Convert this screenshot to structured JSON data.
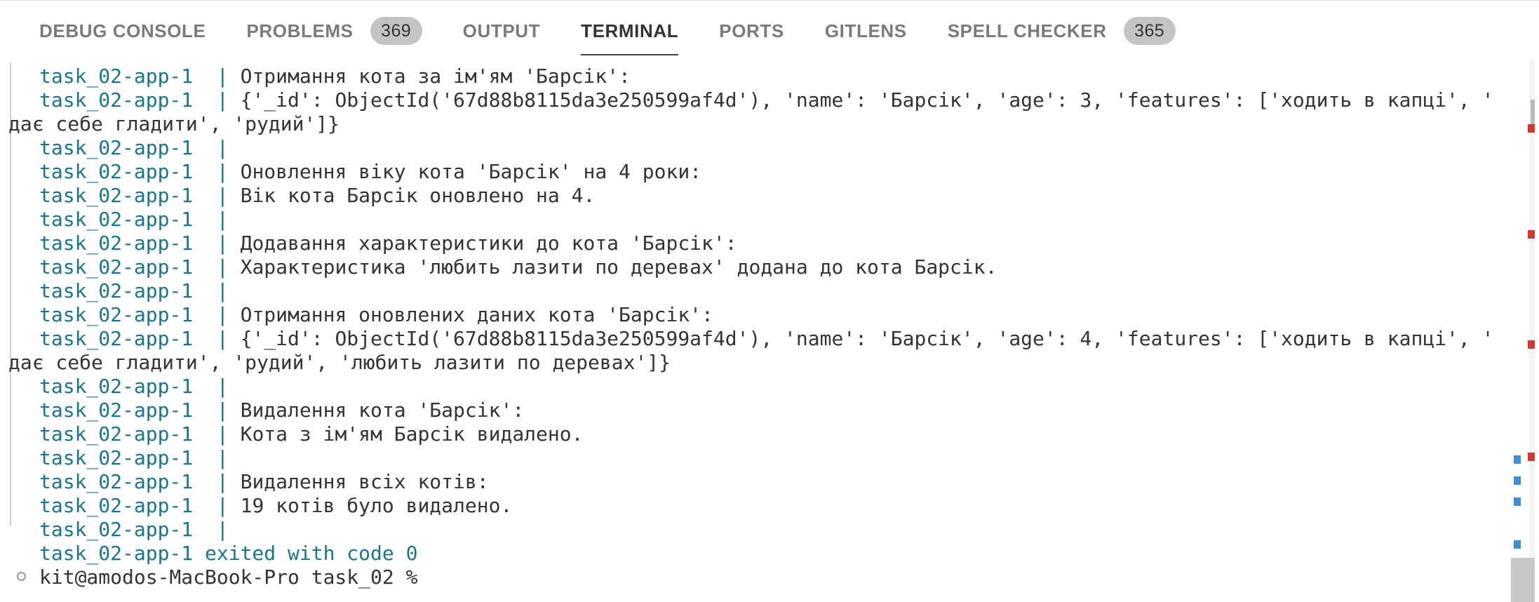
{
  "tabs": [
    {
      "label": "DEBUG CONSOLE",
      "badge": null,
      "active": false
    },
    {
      "label": "PROBLEMS",
      "badge": "369",
      "active": false
    },
    {
      "label": "OUTPUT",
      "badge": null,
      "active": false
    },
    {
      "label": "TERMINAL",
      "badge": null,
      "active": true
    },
    {
      "label": "PORTS",
      "badge": null,
      "active": false
    },
    {
      "label": "GITLENS",
      "badge": null,
      "active": false
    },
    {
      "label": "SPELL CHECKER",
      "badge": "365",
      "active": false
    }
  ],
  "terminal": {
    "prefix": "task_02-app-1  ",
    "pipe": "|",
    "lines": [
      {
        "text": " Отримання кота за ім'ям 'Барсік':"
      },
      {
        "text": " {'_id': ObjectId('67d88b8115da3e250599af4d'), 'name': 'Барсік', 'age': 3, 'features': ['ходить в капці', '",
        "continuation": "дає себе гладити', 'рудий']}"
      },
      {
        "text": ""
      },
      {
        "text": " Оновлення віку кота 'Барсік' на 4 роки:"
      },
      {
        "text": " Вік кота Барсік оновлено на 4."
      },
      {
        "text": ""
      },
      {
        "text": " Додавання характеристики до кота 'Барсік':"
      },
      {
        "text": " Характеристика 'любить лазити по деревах' додана до кота Барсік."
      },
      {
        "text": ""
      },
      {
        "text": " Отримання оновлених даних кота 'Барсік':"
      },
      {
        "text": " {'_id': ObjectId('67d88b8115da3e250599af4d'), 'name': 'Барсік', 'age': 4, 'features': ['ходить в капці', '",
        "continuation": "дає себе гладити', 'рудий', 'любить лазити по деревах']}"
      },
      {
        "text": ""
      },
      {
        "text": " Видалення кота 'Барсік':"
      },
      {
        "text": " Кота з ім'ям Барсік видалено."
      },
      {
        "text": ""
      },
      {
        "text": " Видалення всіх котів:"
      },
      {
        "text": " 19 котів було видалено."
      },
      {
        "text": ""
      }
    ],
    "exit_line": "task_02-app-1 exited with code 0",
    "prompt": "kit@amodos-MacBook-Pro task_02 % "
  },
  "colors": {
    "prefix": "#19748f",
    "error_marker": "#d03a2e",
    "info_marker": "#3d8fd1"
  }
}
